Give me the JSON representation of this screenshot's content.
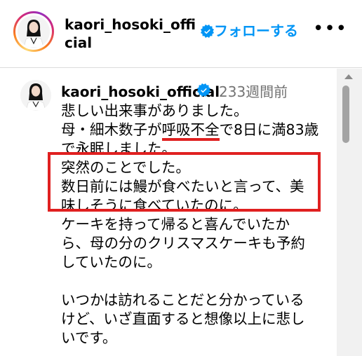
{
  "header": {
    "username": "kaori_hosoki_official",
    "verified": true,
    "follow_label": "フォローする",
    "more_label": "•••"
  },
  "post": {
    "username": "kaori_hosoki_official",
    "verified": true,
    "time": "233週間前",
    "caption_lines": [
      "悲しい出来事がありました。",
      "母・細木数子が呼吸不全で8日に満83歳",
      "で永眠しました。",
      "突然のことでした。",
      "数日前には鰻が食べたいと言って、美",
      "味しそうに食べていたのに。",
      "ケーキを持って帰ると喜んでいたか",
      "ら、母の分のクリスマスケーキも予約",
      "していたのに。",
      "",
      "いつかは訪れることだと分かっている",
      "けど、いざ直面すると想像以上に悲し",
      "いです。"
    ],
    "line2_parts": {
      "before": "母・細木数子が",
      "underlined": "呼吸不全",
      "after": "で8日に満83歳"
    }
  },
  "colors": {
    "accent_blue": "#0095f6",
    "highlight_red": "#e02020",
    "secondary_text": "#737373"
  },
  "icons": [
    "verified-badge-icon",
    "more-options-icon",
    "scroll-up-arrow-icon"
  ]
}
